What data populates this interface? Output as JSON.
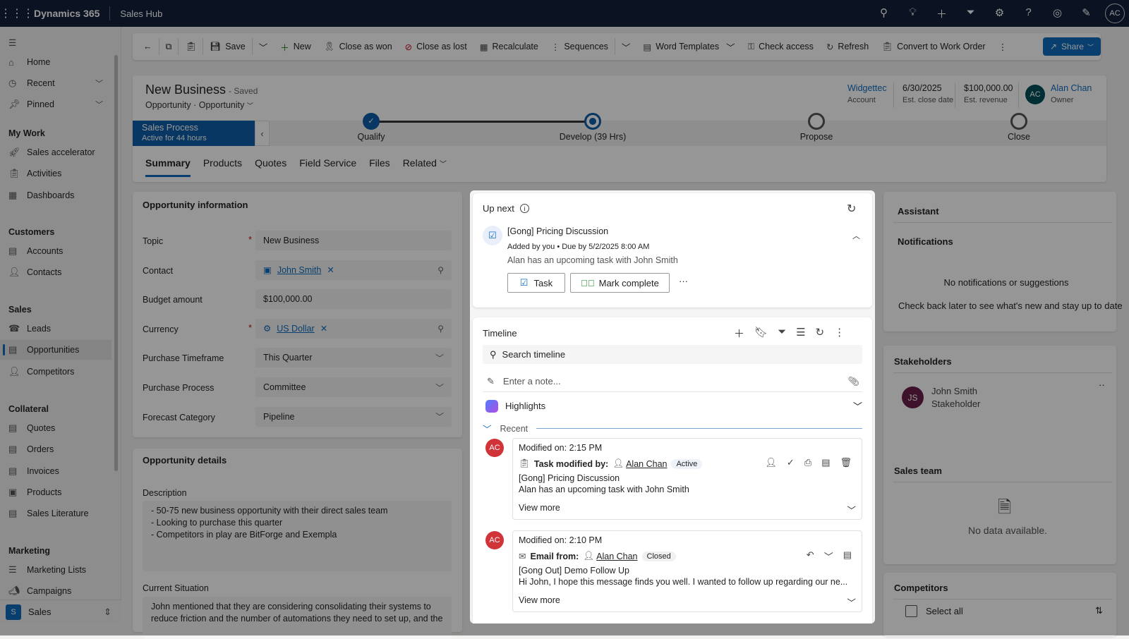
{
  "topbar": {
    "brand": "Dynamics 365",
    "app": "Sales Hub",
    "user_initials": "AC"
  },
  "sidebar": {
    "items": [
      {
        "label": "Home"
      },
      {
        "label": "Recent"
      },
      {
        "label": "Pinned"
      }
    ],
    "groups": [
      {
        "title": "My Work",
        "items": [
          "Sales accelerator",
          "Activities",
          "Dashboards"
        ]
      },
      {
        "title": "Customers",
        "items": [
          "Accounts",
          "Contacts"
        ]
      },
      {
        "title": "Sales",
        "items": [
          "Leads",
          "Opportunities",
          "Competitors"
        ]
      },
      {
        "title": "Collateral",
        "items": [
          "Quotes",
          "Orders",
          "Invoices",
          "Products",
          "Sales Literature"
        ]
      },
      {
        "title": "Marketing",
        "items": [
          "Marketing Lists",
          "Campaigns"
        ]
      }
    ],
    "selected": "Opportunities",
    "area": {
      "initial": "S",
      "label": "Sales"
    }
  },
  "commandbar": {
    "save": "Save",
    "new": "New",
    "close_won": "Close as won",
    "close_lost": "Close as lost",
    "recalculate": "Recalculate",
    "sequences": "Sequences",
    "word_templates": "Word Templates",
    "check_access": "Check access",
    "refresh": "Refresh",
    "convert": "Convert to Work Order",
    "share": "Share"
  },
  "header": {
    "title": "New Business",
    "status": "- Saved",
    "entity": "Opportunity",
    "form": "Opportunity",
    "fields": [
      {
        "value": "Widgettec",
        "label": "Account"
      },
      {
        "value": "6/30/2025",
        "label": "Est. close date"
      },
      {
        "value": "$100,000.00",
        "label": "Est. revenue"
      }
    ],
    "owner": {
      "initials": "AC",
      "name": "Alan Chan",
      "label": "Owner"
    }
  },
  "process": {
    "name": "Sales Process",
    "active": "Active for 44 hours",
    "stages": [
      "Qualify",
      "Develop  (39 Hrs)",
      "Propose",
      "Close"
    ],
    "current_stage_index": 1
  },
  "tabs": [
    "Summary",
    "Products",
    "Quotes",
    "Field Service",
    "Files",
    "Related"
  ],
  "opportunity_info": {
    "title": "Opportunity information",
    "fields": [
      {
        "label": "Topic",
        "value": "New Business",
        "required": true
      },
      {
        "label": "Contact",
        "value": "John Smith"
      },
      {
        "label": "Budget amount",
        "value": "$100,000.00"
      },
      {
        "label": "Currency",
        "value": "US Dollar",
        "required": true
      },
      {
        "label": "Purchase Timeframe",
        "value": "This Quarter"
      },
      {
        "label": "Purchase Process",
        "value": "Committee"
      },
      {
        "label": "Forecast Category",
        "value": "Pipeline"
      }
    ]
  },
  "opportunity_details": {
    "title": "Opportunity details",
    "description_label": "Description",
    "description": [
      "- 50-75 new business opportunity with their direct sales team",
      "- Looking to purchase this quarter",
      "- Competitors in play are BitForge and Exempla"
    ],
    "situation_label": "Current Situation",
    "situation": [
      "John mentioned that they are considering consolidating their systems to",
      "reduce friction and the number of automations they need to set up, and the"
    ]
  },
  "upnext": {
    "title": "Up next",
    "item_title": "[Gong] Pricing Discussion",
    "meta": "Added by you • Due by 5/2/2025 8:00 AM",
    "desc": "Alan has an upcoming task with John Smith",
    "task_btn": "Task",
    "complete_btn": "Mark complete"
  },
  "timeline": {
    "title": "Timeline",
    "search_placeholder": "Search timeline",
    "note_placeholder": "Enter a note...",
    "highlights": "Highlights",
    "recent": "Recent",
    "entries": [
      {
        "initials": "AC",
        "modified": "Modified on: 2:15 PM",
        "kind": "Task modified by:",
        "who": "Alan Chan",
        "status": "Active",
        "subject": "[Gong] Pricing Discussion",
        "body": "Alan has an upcoming task with John Smith",
        "more": "View more"
      },
      {
        "initials": "AC",
        "modified": "Modified on: 2:10 PM",
        "kind": "Email from:",
        "who": "Alan Chan",
        "status": "Closed",
        "subject": "[Gong Out] Demo Follow Up",
        "body": "Hi John,   I hope this message finds you well. I wanted to follow up regarding our ne...",
        "more": "View more"
      }
    ]
  },
  "assistant": {
    "title": "Assistant",
    "notifications": "Notifications",
    "empty": "No notifications or suggestions",
    "hint": "Check back later to see what's new and stay up to date"
  },
  "stakeholders": {
    "title": "Stakeholders",
    "name": "John Smith",
    "role": "Stakeholder",
    "initials": "JS"
  },
  "sales_team": {
    "title": "Sales team",
    "empty": "No data available."
  },
  "competitors": {
    "title": "Competitors",
    "select_all": "Select all"
  }
}
